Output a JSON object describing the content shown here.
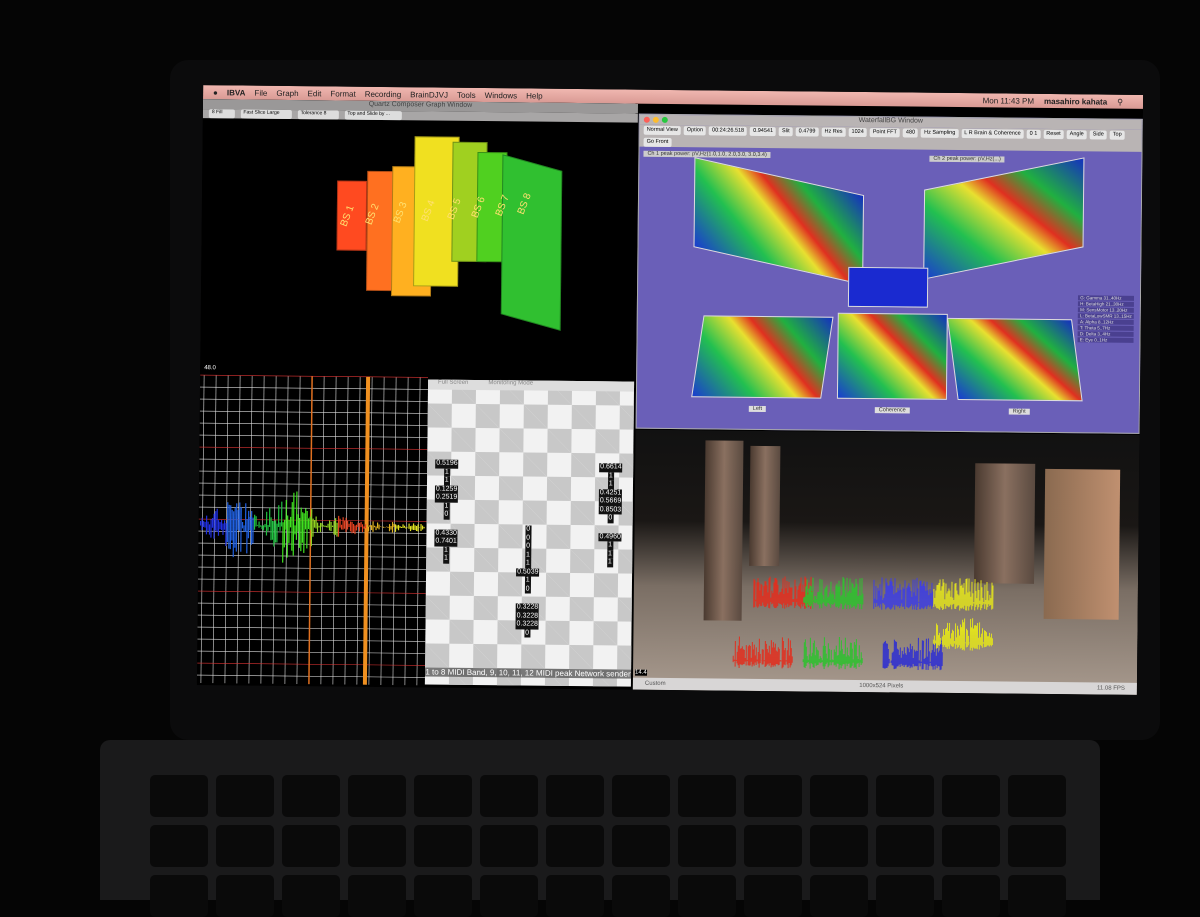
{
  "menubar": {
    "app": "IBVA",
    "items": [
      "File",
      "Graph",
      "Edit",
      "Format",
      "Recording",
      "BrainDJVJ",
      "Tools",
      "Windows",
      "Help"
    ],
    "clock": "Mon 11:43 PM",
    "user": "masahiro kahata"
  },
  "qc": {
    "title": "Quartz Composer Graph Window",
    "controls": [
      "8 Fill",
      "Fast Slice Large",
      "Tolerance 8",
      "Top and Slide by ..."
    ],
    "bars": [
      "BS 1",
      "BS 2",
      "BS 3",
      "BS 4",
      "BS 5",
      "BS 6",
      "BS 7",
      "BS 8"
    ]
  },
  "wave": {
    "top_label": "48.0",
    "bottom_label": "14.4"
  },
  "monitor": {
    "title": "Monitoring Mode",
    "full_screen": "Full Screen",
    "caption": "1 to 8 MIDI Band, 9, 10, 11, 12 MIDI peak Network sender",
    "columns": [
      [
        "0.5196",
        "1",
        "1",
        "0.1259",
        "0.2519",
        "1",
        "0",
        "",
        "0.4330",
        "0.7401",
        "1",
        "1"
      ],
      [
        "0",
        "0",
        "0",
        "1",
        "1",
        "0.5039",
        "1",
        "0",
        "",
        "0.3228",
        "0.3228",
        "0.3228",
        "0"
      ],
      [
        "0.6614",
        "1",
        "1",
        "0.4251",
        "0.5669",
        "0.8503",
        "0",
        "",
        "0.4960",
        "1",
        "1",
        "1"
      ]
    ]
  },
  "waterfall": {
    "title": "WaterfallBG Window",
    "controls": [
      "Normal View",
      "Option",
      "00:24:26.518",
      "0.94541",
      "Slit",
      "0.4799",
      "Hz Res",
      "1024",
      "Point FFT",
      "480",
      "Hz Sampling",
      "L R Brain & Coherence",
      "0 1",
      "Reset",
      "Angle",
      "Side",
      "Top",
      "Go Front"
    ],
    "ch1": "Ch 1 peak power: pV,Hz(1.0,1.0, 2.0,3.0, 3.0,3.4)",
    "ch2": "Ch 2 peak power: pV,Hz(...)",
    "legend": [
      "G: Gamma 31..40Hz",
      "H: BetaHigh 21..30Hz",
      "M: SensMotor 13..20Hz",
      "L: BetaLowSMR 13..15Hz",
      "A: Alpha 8..12Hz",
      "T: Theta 5..7Hz",
      "D: Delta 3..4Hz",
      "E: Eye 0..1Hz"
    ],
    "bottom": [
      "Left",
      "Coherence",
      "Right"
    ]
  },
  "camera": {
    "mode": "Custom",
    "size": "1000x524 Pixels",
    "fps": "11.08 FPS"
  }
}
